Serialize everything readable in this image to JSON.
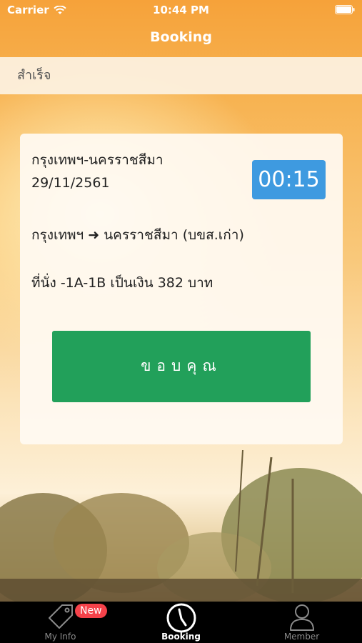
{
  "status_bar": {
    "carrier": "Carrier",
    "time": "10:44 PM"
  },
  "nav": {
    "title": "Booking"
  },
  "subheader": {
    "text": "สำเร็จ"
  },
  "ticket": {
    "route_title": "กรุงเทพฯ-นครราชสีมา",
    "date": "29/11/2561",
    "timer": "00:15",
    "route_detail": "กรุงเทพฯ ➜ นครราชสีมา (บขส.เก่า)",
    "seat_detail": "ที่นั่ง -1A-1B เป็นเงิน 382 บาท",
    "thanks_button": "ขอบคุณ"
  },
  "tabs": [
    {
      "label": "My Info",
      "badge": "New",
      "icon": "tag-icon"
    },
    {
      "label": "Booking",
      "icon": "clock-icon",
      "active": true
    },
    {
      "label": "Member",
      "icon": "person-icon"
    }
  ],
  "colors": {
    "nav_orange": "#f6a23a",
    "timer_blue": "#3e9ae0",
    "button_green": "#22a05a",
    "badge_red": "#f5424a"
  }
}
